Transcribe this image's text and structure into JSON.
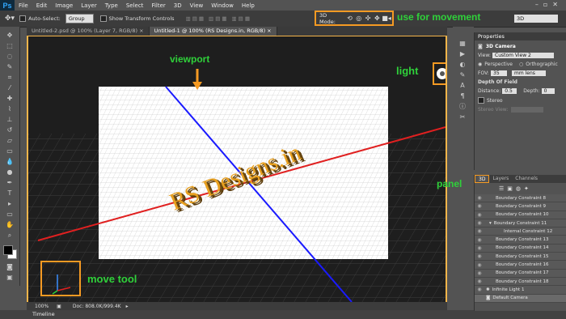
{
  "app": {
    "logo": "Ps"
  },
  "menu": [
    "File",
    "Edit",
    "Image",
    "Layer",
    "Type",
    "Select",
    "Filter",
    "3D",
    "View",
    "Window",
    "Help"
  ],
  "options": {
    "auto_select_label": "Auto-Select:",
    "auto_select_value": "Group",
    "transform_label": "Show Transform Controls",
    "mode_label": "3D Mode:",
    "view_select": "3D"
  },
  "tabs": [
    {
      "label": "Untitled-2.psd @ 100% (Layer 7, RGB/8) ×"
    },
    {
      "label": "Untitled-1 @ 100% (RS Designs.in, RGB/8) ×"
    }
  ],
  "canvas": {
    "text3d": "RS Designs.in"
  },
  "status": {
    "zoom": "100%",
    "doc": "Doc: 808.0K/999.4K"
  },
  "timeline": "Timeline",
  "annotations": {
    "movement": "use for movement",
    "viewport": "viewport",
    "light": "light",
    "panel": "panel",
    "move_tool": "move tool"
  },
  "properties": {
    "tab": "Properties",
    "title": "3D Camera",
    "view_label": "View:",
    "view_value": "Custom View 2",
    "perspective": "Perspective",
    "orthographic": "Orthographic",
    "fov_label": "FOV:",
    "fov_value": "35",
    "fov_unit": "mm lens",
    "dof_label": "Depth Of Field",
    "distance_label": "Distance:",
    "distance_value": "0.5",
    "depth_label": "Depth:",
    "depth_value": "0",
    "stereo_label": "Stereo",
    "stereo_view_label": "Stereo View:"
  },
  "layers_panel": {
    "tabs": [
      "3D",
      "Layers",
      "Channels"
    ],
    "rows": [
      "Boundary Constraint 8",
      "Boundary Constraint 9",
      "Boundary Constraint 10",
      "Boundary Constraint 11",
      "Internal Constraint 12",
      "Boundary Constraint 13",
      "Boundary Constraint 14",
      "Boundary Constraint 15",
      "Boundary Constraint 16",
      "Boundary Constraint 17",
      "Boundary Constraint 18",
      "Infinite Light 1",
      "Default Camera"
    ]
  },
  "colors": {
    "accent": "#f59a23",
    "annotation": "#2fd13a",
    "axis_red": "#e02020",
    "axis_blue": "#1a1aff",
    "text3d": "#e8a020"
  }
}
